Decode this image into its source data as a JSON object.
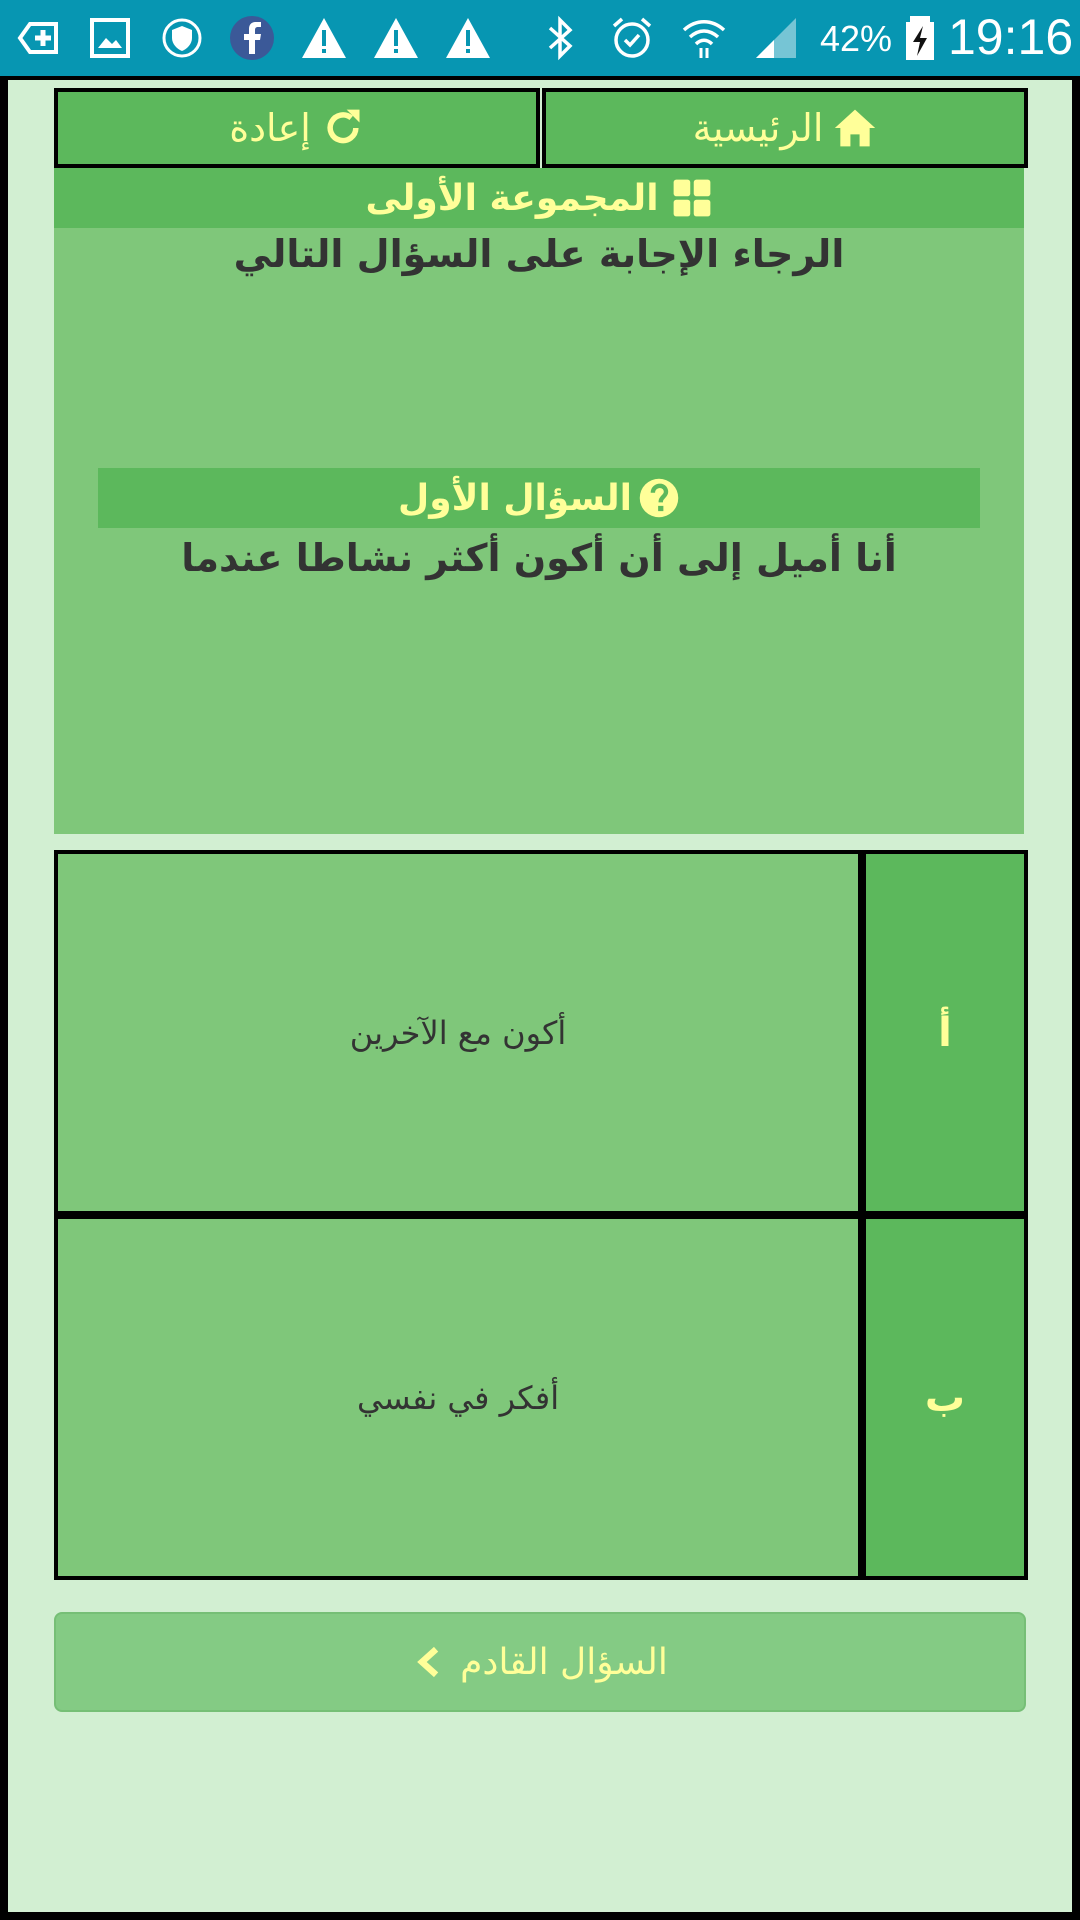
{
  "status_bar": {
    "battery_percent": "42%",
    "clock": "19:16"
  },
  "nav": {
    "home_label": "الرئيسية",
    "reset_label": "إعادة"
  },
  "group": {
    "title": "المجموعة الأولى",
    "instruction": "الرجاء الإجابة على السؤال التالي"
  },
  "question": {
    "title": "السؤال الأول",
    "text": "أنا أميل إلى أن أكون أكثر نشاطا عندما"
  },
  "answers": [
    {
      "letter": "أ",
      "text": "أكون مع الآخرين"
    },
    {
      "letter": "ب",
      "text": "أفكر في نفسي"
    }
  ],
  "next_button": {
    "label": "السؤال القادم"
  },
  "colors": {
    "status_bar": "#0796b2",
    "accent_green": "#5cb85c",
    "panel_green": "#7fc77a",
    "background": "#d2efd2",
    "label_yellow": "#ffff99"
  }
}
